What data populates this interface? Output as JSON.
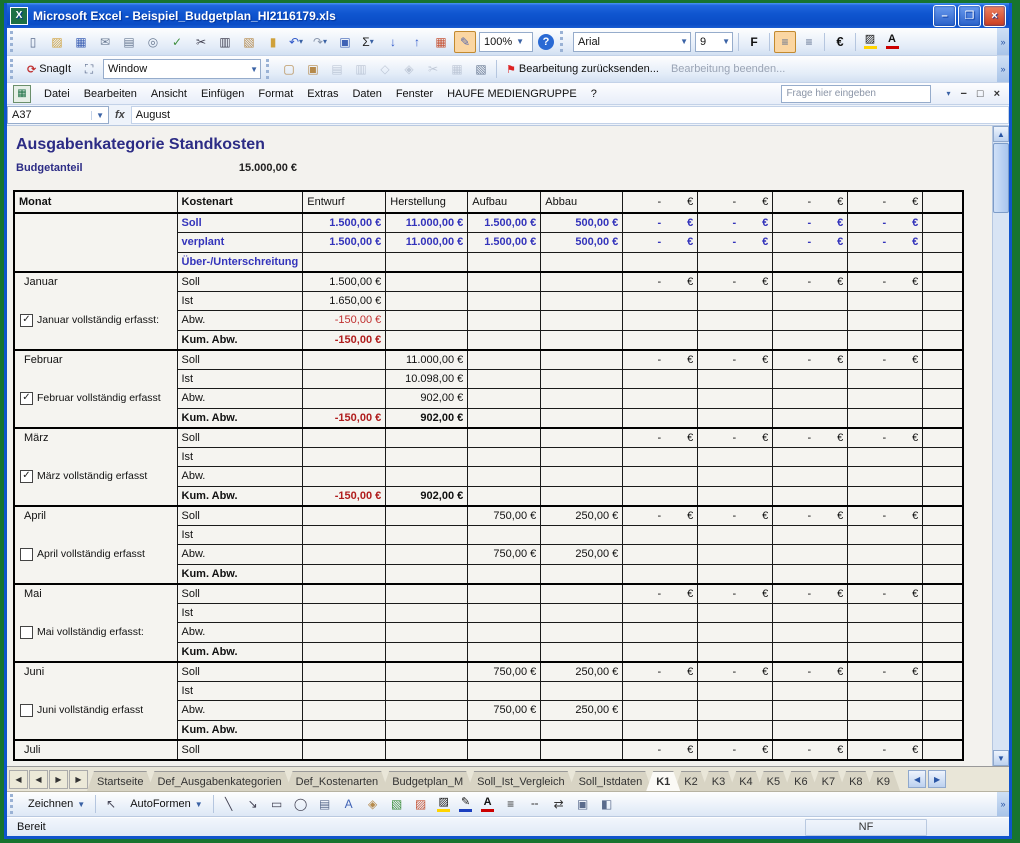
{
  "colors": {
    "titlebar_blue": "#0f55cf",
    "desktop_green": "#17742f",
    "summary_blue": "#3434bb",
    "negative_red": "#b01d1d",
    "title_navy": "#2c2c85",
    "highlight_orange": "#fbd6a2"
  },
  "window": {
    "title": "Microsoft Excel - Beispiel_Budgetplan_HI2116179.xls",
    "minimize_glyph": "–",
    "restore_glyph": "❐",
    "close_glyph": "×"
  },
  "toolbar_standard": {
    "zoom_value": "100%",
    "help_label": "?",
    "icons": [
      {
        "name": "new-icon",
        "glyph": "▯",
        "color": "#5a6b8c"
      },
      {
        "name": "open-icon",
        "glyph": "▨",
        "color": "#cfa13b"
      },
      {
        "name": "save-icon",
        "glyph": "▦",
        "color": "#3f62b5"
      },
      {
        "name": "mail-icon",
        "glyph": "✉",
        "color": "#6b7b94"
      },
      {
        "name": "print-icon",
        "glyph": "▤",
        "color": "#6b7b94"
      },
      {
        "name": "print-preview-icon",
        "glyph": "◎",
        "color": "#6b7b94"
      },
      {
        "name": "spelling-icon",
        "glyph": "✓",
        "color": "#3f8f3f"
      },
      {
        "name": "cut-icon",
        "glyph": "✂",
        "color": "#444455"
      },
      {
        "name": "copy-icon",
        "glyph": "▥",
        "color": "#444455"
      },
      {
        "name": "paste-icon",
        "glyph": "▧",
        "color": "#b5894a"
      },
      {
        "name": "format-painter-icon",
        "glyph": "▮",
        "color": "#cfa13b"
      },
      {
        "name": "undo-icon",
        "glyph": "↶",
        "color": "#2e57c9",
        "dd": true
      },
      {
        "name": "redo-icon",
        "glyph": "↷",
        "color": "#8a97ad",
        "dd": true
      },
      {
        "name": "hyperlink-icon",
        "glyph": "▣",
        "color": "#3f62b5"
      },
      {
        "name": "autosum-icon",
        "glyph": "Σ",
        "color": "#222222",
        "dd": true
      },
      {
        "name": "sort-ascending-icon",
        "glyph": "↓",
        "color": "#2e57c9"
      },
      {
        "name": "sort-descending-icon",
        "glyph": "↑",
        "color": "#2e57c9"
      },
      {
        "name": "chart-wizard-icon",
        "glyph": "▦",
        "color": "#c65537"
      },
      {
        "name": "drawing-toggle-icon",
        "glyph": "✎",
        "color": "#5566aa",
        "hl": true
      }
    ]
  },
  "toolbar_formatting": {
    "font_name": "Arial",
    "font_size": "9",
    "bold_label": "F",
    "euro_label": "€",
    "align_icons": [
      {
        "name": "align-left-icon",
        "glyph": "≡",
        "color": "#5a6b8c",
        "hl": true
      },
      {
        "name": "align-center-icon",
        "glyph": "≡",
        "color": "#5a6b8c"
      }
    ],
    "color_buttons": [
      {
        "name": "fill-color-icon",
        "glyph": "▨",
        "bar": "#ffd400"
      },
      {
        "name": "font-color-icon",
        "glyph": "A",
        "bar": "#cc0000"
      }
    ]
  },
  "toolbar_snagit": {
    "app_label": "SnagIt",
    "capture_glyph": "⛶",
    "window_label": "Window"
  },
  "toolbar_reviewing": {
    "send_edit_label": "Bearbeitung zurücksenden...",
    "end_edit_label": "Bearbeitung beenden...",
    "flag_glyph": "⚑",
    "icons": [
      {
        "name": "insert-comment-icon",
        "glyph": "▢",
        "color": "#b5894a"
      },
      {
        "name": "edit-comment-icon",
        "glyph": "▣",
        "color": "#b5894a"
      },
      {
        "name": "previous-comment-icon",
        "glyph": "▤",
        "color": "#8a97ad",
        "dim": true
      },
      {
        "name": "next-comment-icon",
        "glyph": "▥",
        "color": "#8a97ad",
        "dim": true
      },
      {
        "name": "show-comment-icon",
        "glyph": "◇",
        "color": "#8a97ad",
        "dim": true
      },
      {
        "name": "show-all-comments-icon",
        "glyph": "◈",
        "color": "#8a97ad",
        "dim": true
      },
      {
        "name": "delete-comment-icon",
        "glyph": "✂",
        "color": "#8a97ad",
        "dim": true
      },
      {
        "name": "update-file-icon",
        "glyph": "▦",
        "color": "#8a97ad",
        "dim": true
      },
      {
        "name": "mail-recipient-icon",
        "glyph": "▧",
        "color": "#6b7b94"
      }
    ]
  },
  "menubar": {
    "items": [
      "Datei",
      "Bearbeiten",
      "Ansicht",
      "Einfügen",
      "Format",
      "Extras",
      "Daten",
      "Fenster",
      "HAUFE MEDIENGRUPPE",
      "?"
    ],
    "question_placeholder": "Frage hier eingeben",
    "workbook_controls": {
      "minimize": "−",
      "restore": "□",
      "close": "×",
      "options": "▾"
    }
  },
  "formula_bar": {
    "name_box": "A37",
    "fx_label": "fx",
    "content": "August"
  },
  "sheet": {
    "title": "Ausgabenkategorie Standkosten",
    "budget_label": "Budgetanteil",
    "budget_value": "15.000,00 €",
    "table": {
      "columns": [
        "Monat",
        "Kostenart",
        "Entwurf",
        "Herstellung",
        "Aufbau",
        "Abbau",
        "- €",
        "- €",
        "- €",
        "- €"
      ],
      "dash_minus": "-",
      "dash_euro": "€",
      "summary_rows": [
        {
          "label": "Soll",
          "values": [
            "1.500,00 €",
            "11.000,00 €",
            "1.500,00 €",
            "500,00 €"
          ],
          "dash": true
        },
        {
          "label": "verplant",
          "values": [
            "1.500,00 €",
            "11.000,00 €",
            "1.500,00 €",
            "500,00 €"
          ],
          "dash": true
        },
        {
          "label": "Über-/Unterschreitung",
          "values": [
            "",
            "",
            "",
            ""
          ],
          "dash": false
        }
      ],
      "months": [
        {
          "name": "Januar",
          "checkbox": "Januar vollständig erfasst:",
          "checked": true,
          "rows": [
            {
              "label": "Soll",
              "values": [
                "1.500,00 €",
                "",
                "",
                ""
              ],
              "dash": true
            },
            {
              "label": "Ist",
              "values": [
                "1.650,00 €",
                "",
                "",
                ""
              ]
            },
            {
              "label": "Abw.",
              "values": [
                "-150,00 €",
                "",
                "",
                ""
              ],
              "styles": [
                "neg",
                "",
                "",
                ""
              ]
            },
            {
              "label": "Kum. Abw.",
              "bold": true,
              "values": [
                "-150,00 €",
                "",
                "",
                ""
              ],
              "styles": [
                "negb",
                "",
                "",
                ""
              ]
            }
          ]
        },
        {
          "name": "Februar",
          "checkbox": "Februar vollständig erfasst",
          "checked": true,
          "rows": [
            {
              "label": "Soll",
              "values": [
                "",
                "11.000,00 €",
                "",
                ""
              ],
              "dash": true
            },
            {
              "label": "Ist",
              "values": [
                "",
                "10.098,00 €",
                "",
                ""
              ]
            },
            {
              "label": "Abw.",
              "values": [
                "",
                "902,00 €",
                "",
                ""
              ]
            },
            {
              "label": "Kum. Abw.",
              "bold": true,
              "values": [
                "-150,00 €",
                "902,00 €",
                "",
                ""
              ],
              "styles": [
                "negb",
                "posb",
                "",
                ""
              ]
            }
          ]
        },
        {
          "name": "März",
          "checkbox": "März vollständig erfasst",
          "checked": true,
          "rows": [
            {
              "label": "Soll",
              "values": [
                "",
                "",
                "",
                ""
              ],
              "dash": true
            },
            {
              "label": "Ist",
              "values": [
                "",
                "",
                "",
                ""
              ]
            },
            {
              "label": "Abw.",
              "values": [
                "",
                "",
                "",
                ""
              ]
            },
            {
              "label": "Kum. Abw.",
              "bold": true,
              "values": [
                "-150,00 €",
                "902,00 €",
                "",
                ""
              ],
              "styles": [
                "negb",
                "posb",
                "",
                ""
              ]
            }
          ]
        },
        {
          "name": "April",
          "checkbox": "April vollständig erfasst",
          "checked": false,
          "rows": [
            {
              "label": "Soll",
              "values": [
                "",
                "",
                "750,00 €",
                "250,00 €"
              ],
              "dash": true
            },
            {
              "label": "Ist",
              "values": [
                "",
                "",
                "",
                ""
              ]
            },
            {
              "label": "Abw.",
              "values": [
                "",
                "",
                "750,00 €",
                "250,00 €"
              ]
            },
            {
              "label": "Kum. Abw.",
              "bold": true,
              "values": [
                "",
                "",
                "",
                ""
              ]
            }
          ]
        },
        {
          "name": "Mai",
          "checkbox": "Mai vollständig erfasst:",
          "checked": false,
          "rows": [
            {
              "label": "Soll",
              "values": [
                "",
                "",
                "",
                ""
              ],
              "dash": true
            },
            {
              "label": "Ist",
              "values": [
                "",
                "",
                "",
                ""
              ]
            },
            {
              "label": "Abw.",
              "values": [
                "",
                "",
                "",
                ""
              ]
            },
            {
              "label": "Kum. Abw.",
              "bold": true,
              "values": [
                "",
                "",
                "",
                ""
              ]
            }
          ]
        },
        {
          "name": "Juni",
          "checkbox": "Juni vollständig erfasst",
          "checked": false,
          "rows": [
            {
              "label": "Soll",
              "values": [
                "",
                "",
                "750,00 €",
                "250,00 €"
              ],
              "dash": true
            },
            {
              "label": "Ist",
              "values": [
                "",
                "",
                "",
                ""
              ]
            },
            {
              "label": "Abw.",
              "values": [
                "",
                "",
                "750,00 €",
                "250,00 €"
              ]
            },
            {
              "label": "Kum. Abw.",
              "bold": true,
              "values": [
                "",
                "",
                "",
                ""
              ]
            }
          ]
        },
        {
          "name": "Juli",
          "rows": [
            {
              "label": "Soll",
              "values": [
                "",
                "",
                "",
                ""
              ],
              "dash": true
            }
          ]
        }
      ]
    }
  },
  "sheet_tabs": {
    "nav_glyphs": [
      "◀",
      "◀",
      "▶",
      "▶"
    ],
    "tabs": [
      {
        "label": "Startseite"
      },
      {
        "label": "Def_Ausgabenkategorien"
      },
      {
        "label": "Def_Kostenarten"
      },
      {
        "label": "Budgetplan_M"
      },
      {
        "label": "Soll_Ist_Vergleich"
      },
      {
        "label": "Soll_Istdaten"
      },
      {
        "label": "K1",
        "active": true
      },
      {
        "label": "K2"
      },
      {
        "label": "K3"
      },
      {
        "label": "K4"
      },
      {
        "label": "K5"
      },
      {
        "label": "K6"
      },
      {
        "label": "K7"
      },
      {
        "label": "K8"
      },
      {
        "label": "K9"
      }
    ],
    "scroll_glyphs": [
      "◀",
      "▶"
    ]
  },
  "drawing_toolbar": {
    "draw_label": "Zeichnen",
    "autoshapes_label": "AutoFormen",
    "select_icon": {
      "name": "select-arrow-icon",
      "glyph": "↖",
      "color": "#444455"
    },
    "icons": [
      {
        "name": "line-icon",
        "glyph": "╲",
        "color": "#444455"
      },
      {
        "name": "arrow-icon",
        "glyph": "↘",
        "color": "#444455"
      },
      {
        "name": "rectangle-icon",
        "glyph": "▭",
        "color": "#444455"
      },
      {
        "name": "oval-icon",
        "glyph": "◯",
        "color": "#444455"
      },
      {
        "name": "textbox-icon",
        "glyph": "▤",
        "color": "#5a6b8c"
      },
      {
        "name": "wordart-icon",
        "glyph": "A",
        "color": "#3f62b5"
      },
      {
        "name": "diagram-icon",
        "glyph": "◈",
        "color": "#b5894a"
      },
      {
        "name": "clipart-icon",
        "glyph": "▧",
        "color": "#3f8f3f"
      },
      {
        "name": "picture-icon",
        "glyph": "▨",
        "color": "#c65537"
      },
      {
        "name": "fill-color-icon",
        "glyph": "▨",
        "bar": "#ffd400"
      },
      {
        "name": "line-color-icon",
        "glyph": "✎",
        "bar": "#1a3fbf"
      },
      {
        "name": "font-color-icon",
        "glyph": "A",
        "bar": "#cc0000"
      },
      {
        "name": "line-style-icon",
        "glyph": "≡",
        "color": "#333333"
      },
      {
        "name": "dash-style-icon",
        "glyph": "╌",
        "color": "#333333"
      },
      {
        "name": "arrow-style-icon",
        "glyph": "⇄",
        "color": "#333333"
      },
      {
        "name": "shadow-style-icon",
        "glyph": "▣",
        "color": "#5a6b8c"
      },
      {
        "name": "threed-style-icon",
        "glyph": "◧",
        "color": "#5a6b8c"
      }
    ]
  },
  "status_bar": {
    "left": "Bereit",
    "right": "NF"
  }
}
